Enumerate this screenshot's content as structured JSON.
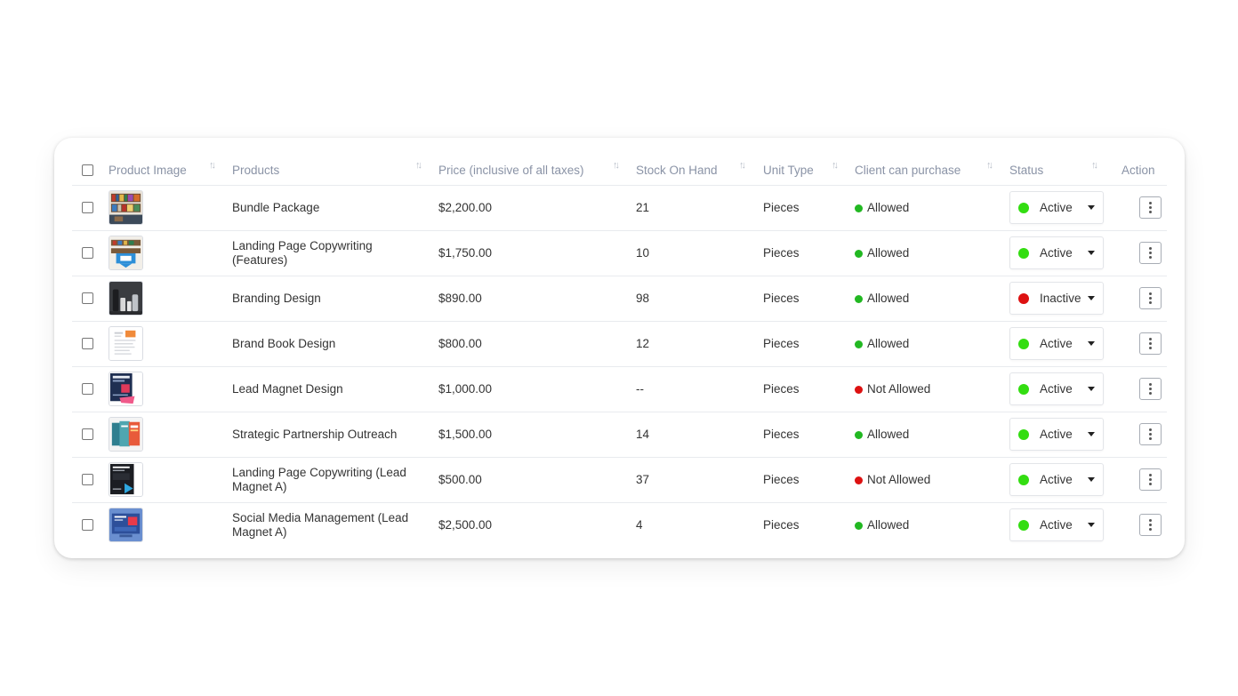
{
  "colors": {
    "allowed": "#22b822",
    "not_allowed": "#dd1111",
    "active": "#33dd11",
    "inactive": "#dd1111",
    "header_text": "#8a93a6"
  },
  "table": {
    "headers": {
      "product_image": "Product Image",
      "products": "Products",
      "price": "Price (inclusive of all taxes)",
      "stock": "Stock On Hand",
      "unit_type": "Unit Type",
      "client_purchase": "Client can purchase",
      "status": "Status",
      "action": "Action"
    },
    "sort_icon": "sort-arrows-icon",
    "rows": [
      {
        "image": "bookshelf-thumbnail",
        "product": "Bundle Package",
        "price": "$2,200.00",
        "stock": "21",
        "unit": "Pieces",
        "purchase": "Allowed",
        "purchase_state": "allowed",
        "status": "Active",
        "status_state": "active"
      },
      {
        "image": "shelf-blue-box-thumbnail",
        "product": "Landing Page Copywriting (Features)",
        "price": "$1,750.00",
        "stock": "10",
        "unit": "Pieces",
        "purchase": "Allowed",
        "purchase_state": "allowed",
        "status": "Active",
        "status_state": "active"
      },
      {
        "image": "dark-bottles-thumbnail",
        "product": "Branding Design",
        "price": "$890.00",
        "stock": "98",
        "unit": "Pieces",
        "purchase": "Allowed",
        "purchase_state": "allowed",
        "status": "Inactive",
        "status_state": "inactive"
      },
      {
        "image": "document-page-thumbnail",
        "product": "Brand Book Design",
        "price": "$800.00",
        "stock": "12",
        "unit": "Pieces",
        "purchase": "Allowed",
        "purchase_state": "allowed",
        "status": "Active",
        "status_state": "active"
      },
      {
        "image": "navy-ebook-thumbnail",
        "product": "Lead Magnet Design",
        "price": "$1,000.00",
        "stock": "--",
        "unit": "Pieces",
        "purchase": "Not Allowed",
        "purchase_state": "not_allowed",
        "status": "Active",
        "status_state": "active"
      },
      {
        "image": "book-covers-thumbnail",
        "product": "Strategic Partnership Outreach",
        "price": "$1,500.00",
        "stock": "14",
        "unit": "Pieces",
        "purchase": "Allowed",
        "purchase_state": "allowed",
        "status": "Active",
        "status_state": "active"
      },
      {
        "image": "dark-ebook-thumbnail",
        "product": "Landing Page Copywriting (Lead Magnet A)",
        "price": "$500.00",
        "stock": "37",
        "unit": "Pieces",
        "purchase": "Not Allowed",
        "purchase_state": "not_allowed",
        "status": "Active",
        "status_state": "active"
      },
      {
        "image": "blue-screen-thumbnail",
        "product": "Social Media Management (Lead Magnet A)",
        "price": "$2,500.00",
        "stock": "4",
        "unit": "Pieces",
        "purchase": "Allowed",
        "purchase_state": "allowed",
        "status": "Active",
        "status_state": "active"
      }
    ]
  }
}
